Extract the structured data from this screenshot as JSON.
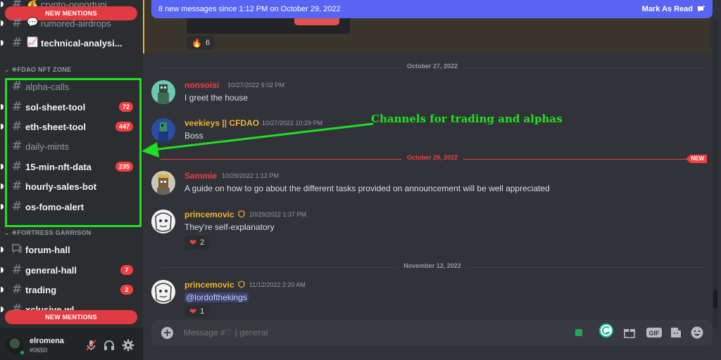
{
  "colors": {
    "accent": "#5865f2",
    "annotation": "#1fe01f",
    "danger": "#f23f43",
    "online": "#23a55a"
  },
  "sidebar": {
    "top_channels": [
      {
        "icon": "money-bag-emoji",
        "emoji": "💰",
        "label": "crypto-opportuni..."
      },
      {
        "icon": "speech-bubble-emoji",
        "emoji": "💬",
        "label": "rumored-airdrops"
      },
      {
        "icon": "chart-emoji",
        "emoji": "📈",
        "label": "technical-analysi..."
      }
    ],
    "new_mentions_top": "NEW MENTIONS",
    "category_nft": "FDAO NFT ZONE",
    "nft_channels": [
      {
        "label": "alpha-calls",
        "badge": ""
      },
      {
        "label": "sol-sheet-tool",
        "badge": "72"
      },
      {
        "label": "eth-sheet-tool",
        "badge": "447"
      },
      {
        "label": "daily-mints",
        "badge": ""
      },
      {
        "label": "15-min-nft-data",
        "badge": "235"
      },
      {
        "label": "hourly-sales-bot",
        "badge": ""
      },
      {
        "label": "os-fomo-alert",
        "badge": ""
      }
    ],
    "category_fortress": "FORTRESS GARRISON",
    "fortress_channels": [
      {
        "label": "forum-hall",
        "badge": "",
        "icon": "forum-icon"
      },
      {
        "label": "general-hall",
        "badge": "7"
      },
      {
        "label": "trading",
        "badge": "2"
      },
      {
        "label": "xclusive-wl",
        "badge": ""
      }
    ],
    "new_mentions_bottom": "NEW MENTIONS"
  },
  "user": {
    "name": "elromena",
    "tag": "#0650"
  },
  "banner": {
    "text": "8 new messages since 1:12 PM on October 29, 2022",
    "action": "Mark As Read"
  },
  "highlight": {
    "reaction_emoji": "🔥",
    "reaction_count": "6"
  },
  "dividers": {
    "oct27": "October 27, 2022",
    "oct29": "October 29, 2022",
    "new_tag": "NEW",
    "nov12": "November 12, 2022"
  },
  "messages": [
    {
      "author": "nonsoisi",
      "author_color": "#f23f43",
      "time": "10/27/2022 9:02 PM",
      "body": "I greet the house"
    },
    {
      "author": "veekieys || CFDAO",
      "author_color": "#f0b232",
      "time": "10/27/2022 10:29 PM",
      "body": "Boss"
    },
    {
      "author": "Sammie",
      "author_color": "#f23f43",
      "time": "10/29/2022 1:12 PM",
      "body": "A guide on how to go about the different tasks provided on announcement will be well appreciated"
    },
    {
      "author": "princemovic",
      "author_color": "#f0b232",
      "time": "10/29/2022 1:37 PM",
      "body": "They're self-explanatory",
      "reaction_emoji": "❤",
      "reaction_count": "2"
    },
    {
      "author": "princemovic",
      "author_color": "#f0b232",
      "time": "11/12/2022 2:20 AM",
      "body": "@lordofthekings",
      "reaction_emoji": "❤",
      "reaction_count": "1"
    }
  ],
  "annotation": {
    "text": "Channels for trading and alphas"
  },
  "composer": {
    "placeholder": "Message #♡ | general"
  }
}
